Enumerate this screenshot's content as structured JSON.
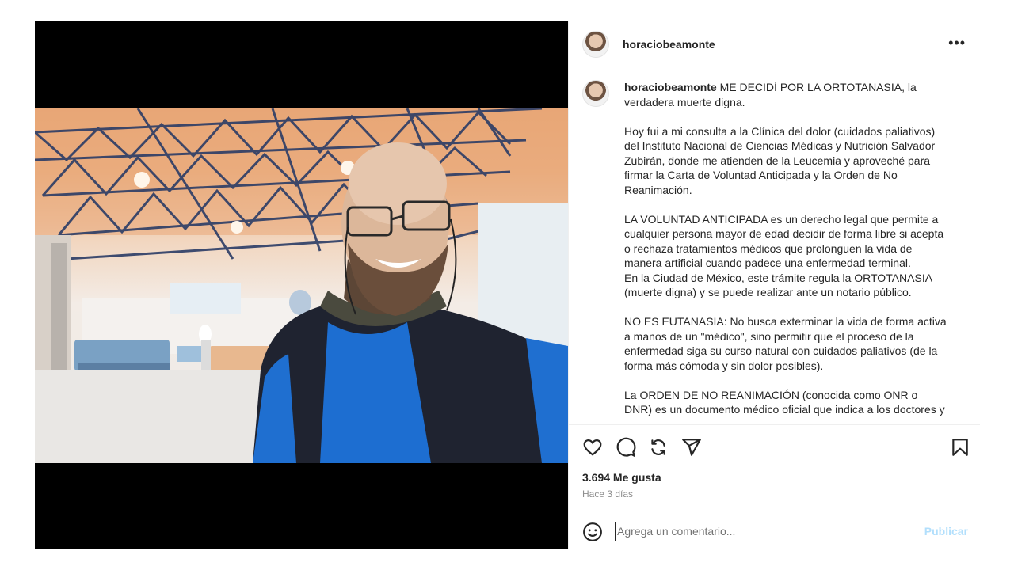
{
  "post": {
    "username": "horaciobeamonte",
    "more_icon": "more-horizontal-icon",
    "caption_intro": "ME DECIDÍ POR LA ORTOTANASIA, la verdadera muerte digna.",
    "caption_body": "\nHoy fui a mi consulta a la Clínica del dolor (cuidados paliativos) del Instituto Nacional de Ciencias Médicas y Nutrición Salvador Zubirán, donde me atienden de la Leucemia y aproveché para firmar la Carta de Voluntad Anticipada y la Orden de No Reanimación.\n\nLA VOLUNTAD ANTICIPADA es un derecho legal que permite a cualquier persona mayor de edad decidir de forma libre si acepta o rechaza tratamientos médicos que prolonguen la vida de manera artificial cuando padece una enfermedad terminal.\nEn la Ciudad de México, este trámite regula la ORTOTANASIA (muerte digna) y se puede realizar ante un notario público.\n\nNO ES EUTANASIA: No busca exterminar la vida de forma activa a manos de un \"médico\", sino permitir que el proceso de la enfermedad siga su curso natural con cuidados paliativos (de la forma más cómoda y sin dolor posibles).\n\nLa ORDEN DE NO REANIMACIÓN (conocida como ONR o DNR) es un documento médico oficial que indica a los doctores y",
    "likes": "3.694 Me gusta",
    "time": "Hace 3 días",
    "comment_placeholder": "Agrega un comentario...",
    "publish_label": "Publicar"
  },
  "icons": {
    "like": "heart-icon",
    "comment": "comment-icon",
    "repost": "repost-icon",
    "share": "send-icon",
    "save": "bookmark-icon",
    "emoji": "emoji-icon"
  },
  "colors": {
    "publish_disabled": "#b2dffc",
    "story_badge": "#8a3ff0"
  }
}
